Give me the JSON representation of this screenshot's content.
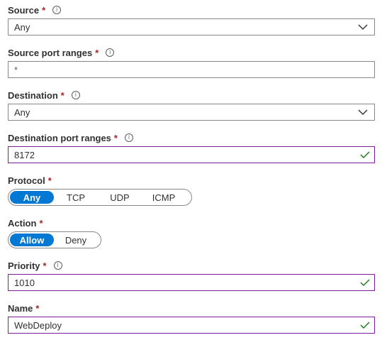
{
  "source": {
    "label": "Source",
    "required_mark": "*",
    "info_icon": "info-icon",
    "value": "Any",
    "dropdown_icon": "chevron-down-icon"
  },
  "source_port_ranges": {
    "label": "Source port ranges",
    "required_mark": "*",
    "info_icon": "info-icon",
    "placeholder": "*"
  },
  "destination": {
    "label": "Destination",
    "required_mark": "*",
    "info_icon": "info-icon",
    "value": "Any",
    "dropdown_icon": "chevron-down-icon"
  },
  "destination_port_ranges": {
    "label": "Destination port ranges",
    "required_mark": "*",
    "info_icon": "info-icon",
    "value": "8172",
    "valid_icon": "checkmark-icon"
  },
  "protocol": {
    "label": "Protocol",
    "required_mark": "*",
    "options": [
      "Any",
      "TCP",
      "UDP",
      "ICMP"
    ],
    "selected": "Any"
  },
  "action": {
    "label": "Action",
    "required_mark": "*",
    "options": [
      "Allow",
      "Deny"
    ],
    "selected": "Allow"
  },
  "priority": {
    "label": "Priority",
    "required_mark": "*",
    "info_icon": "info-icon",
    "value": "1010",
    "valid_icon": "checkmark-icon"
  },
  "name": {
    "label": "Name",
    "required_mark": "*",
    "value": "WebDeploy",
    "valid_icon": "checkmark-icon"
  },
  "colors": {
    "accent": "#0078d4",
    "required": "#a4262c",
    "valid_border": "#7b1fa2",
    "valid_check": "#107c10",
    "border": "#8a8886"
  }
}
